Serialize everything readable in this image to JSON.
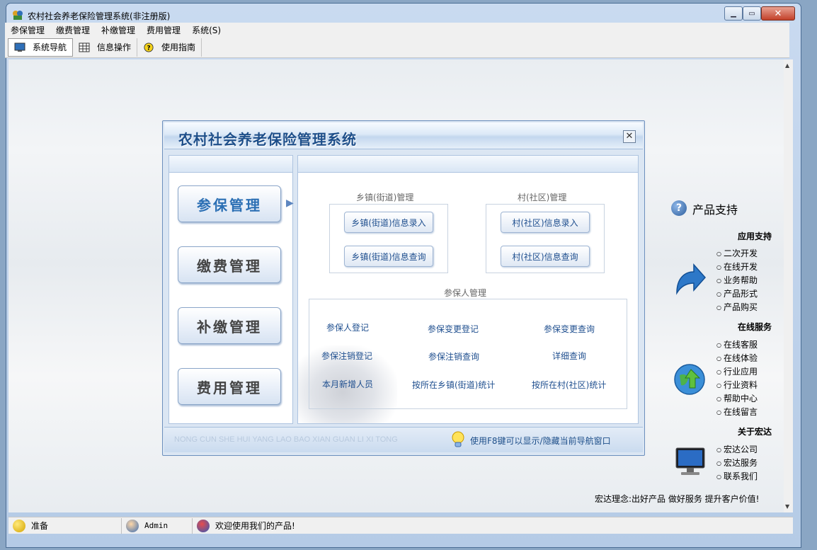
{
  "window": {
    "title": "农村社会养老保险管理系统(非注册版)"
  },
  "menu": [
    "参保管理",
    "缴费管理",
    "补缴管理",
    "费用管理",
    "系统(S)"
  ],
  "toolbar": [
    "系统导航",
    "信息操作",
    "使用指南"
  ],
  "dialog": {
    "title": "农村社会养老保险管理系统",
    "nav": [
      "参保管理",
      "缴费管理",
      "补缴管理",
      "费用管理"
    ],
    "town_group": {
      "label": "乡镇(街道)管理",
      "buttons": [
        "乡镇(街道)信息录入",
        "乡镇(街道)信息查询"
      ]
    },
    "village_group": {
      "label": "村(社区)管理",
      "buttons": [
        "村(社区)信息录入",
        "村(社区)信息查询"
      ]
    },
    "insured_group": {
      "label": "参保人管理",
      "links": [
        "参保人登记",
        "参保变更登记",
        "参保变更查询",
        "参保注销登记",
        "参保注销查询",
        "详细查询",
        "本月新增人员",
        "按所在乡镇(街道)统计",
        "按所在村(社区)统计"
      ]
    },
    "footer_pinyin": "NONG CUN SHE HUI YANG LAO BAO XIAN GUAN LI XI TONG",
    "footer_tip": "使用F8键可以显示/隐藏当前导航窗口"
  },
  "support": {
    "title": "产品支持",
    "app_support": {
      "title": "应用支持",
      "items": [
        "二次开发",
        "在线开发",
        "业务帮助",
        "产品形式",
        "产品购买"
      ]
    },
    "online_service": {
      "title": "在线服务",
      "items": [
        "在线客服",
        "在线体验",
        "行业应用",
        "行业资料",
        "帮助中心",
        "在线留言"
      ]
    },
    "about": {
      "title": "关于宏达",
      "items": [
        "宏达公司",
        "宏达服务",
        "联系我们"
      ]
    },
    "slogan": "宏达理念:出好产品  做好服务  提升客户价值!"
  },
  "status": {
    "state": "准备",
    "user": "Admin",
    "message": "欢迎使用我们的产品!"
  }
}
